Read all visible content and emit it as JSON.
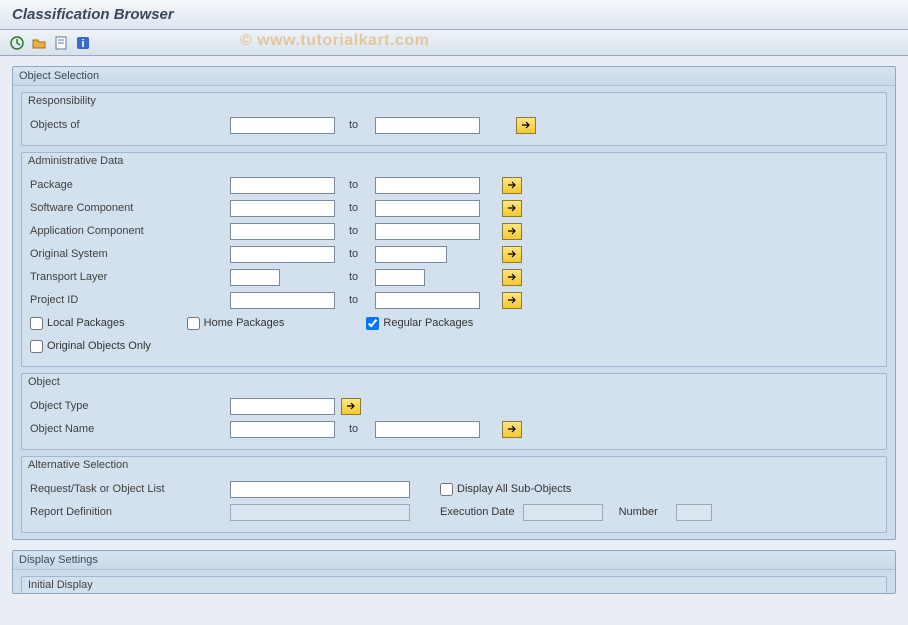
{
  "title": "Classification Browser",
  "watermark": "© www.tutorialkart.com",
  "sections": {
    "object_selection": {
      "title": "Object Selection",
      "responsibility": {
        "title": "Responsibility",
        "objects_of": {
          "label": "Objects of",
          "from": "",
          "to_label": "to",
          "to": ""
        }
      },
      "admin_data": {
        "title": "Administrative Data",
        "package": {
          "label": "Package",
          "from": "",
          "to_label": "to",
          "to": ""
        },
        "software_component": {
          "label": "Software Component",
          "from": "",
          "to_label": "to",
          "to": ""
        },
        "application_component": {
          "label": "Application Component",
          "from": "",
          "to_label": "to",
          "to": ""
        },
        "original_system": {
          "label": "Original System",
          "from": "",
          "to_label": "to",
          "to": ""
        },
        "transport_layer": {
          "label": "Transport Layer",
          "from": "",
          "to_label": "to",
          "to": ""
        },
        "project_id": {
          "label": "Project ID",
          "from": "",
          "to_label": "to",
          "to": ""
        },
        "local_packages": {
          "label": "Local Packages",
          "checked": false
        },
        "home_packages": {
          "label": "Home Packages",
          "checked": false
        },
        "regular_packages": {
          "label": "Regular Packages",
          "checked": true
        },
        "original_objects_only": {
          "label": "Original Objects Only",
          "checked": false
        }
      },
      "object": {
        "title": "Object",
        "object_type": {
          "label": "Object Type",
          "value": ""
        },
        "object_name": {
          "label": "Object Name",
          "from": "",
          "to_label": "to",
          "to": ""
        }
      },
      "alt_selection": {
        "title": "Alternative Selection",
        "request_task": {
          "label": "Request/Task or Object List",
          "value": ""
        },
        "display_all_sub": {
          "label": "Display All Sub-Objects",
          "checked": false
        },
        "report_definition": {
          "label": "Report Definition",
          "value": ""
        },
        "execution_date": {
          "label": "Execution Date",
          "value": ""
        },
        "number": {
          "label": "Number",
          "value": ""
        }
      }
    },
    "display_settings": {
      "title": "Display Settings",
      "initial_display": {
        "title": "Initial Display"
      }
    }
  }
}
